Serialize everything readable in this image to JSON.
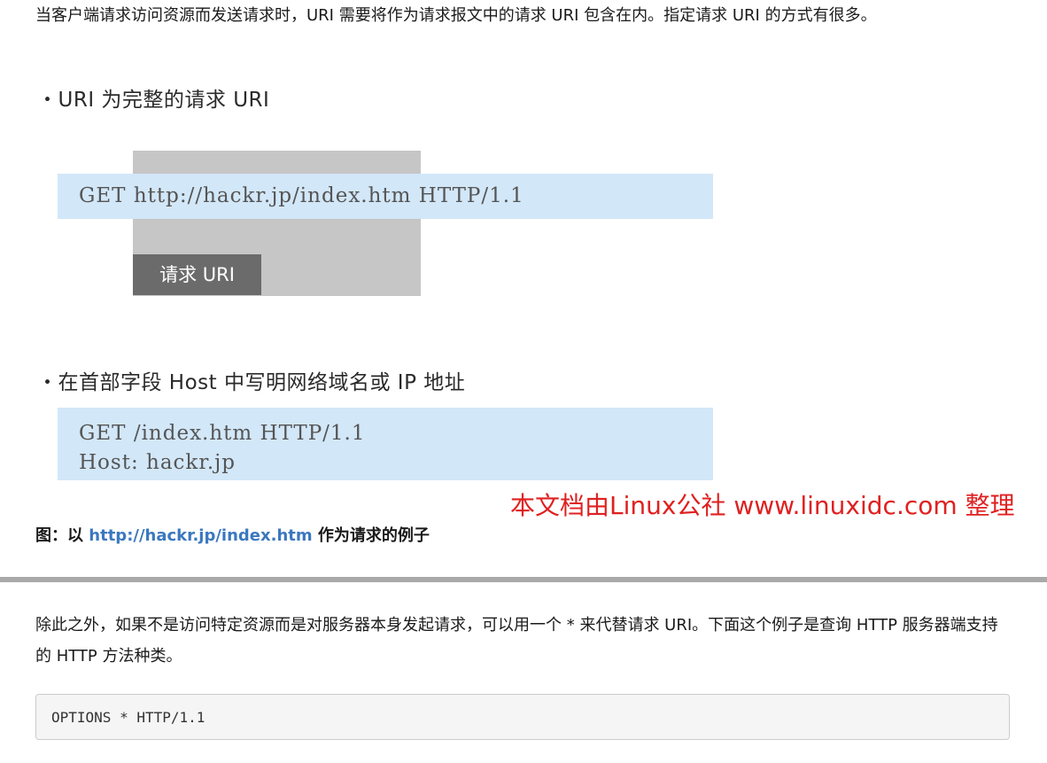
{
  "intro_paragraph": "当客户端请求访问资源而发送请求时，URI 需要将作为请求报文中的请求 URI 包含在内。指定请求 URI 的方式有很多。",
  "diagram1": {
    "bullet": "・URI 为完整的请求 URI",
    "request_line": "GET http://hackr.jp/index.htm HTTP/1.1",
    "tag_label": "请求 URI"
  },
  "diagram2": {
    "bullet": "・在首部字段 Host 中写明网络域名或 IP 地址",
    "request_line": "GET /index.htm HTTP/1.1",
    "host_line": "Host: hackr.jp"
  },
  "watermark": "本文档由Linux公社 www.linuxidc.com 整理",
  "caption": {
    "prefix": "图：以 ",
    "link": "http://hackr.jp/index.htm",
    "suffix": " 作为请求的例子"
  },
  "second_paragraph": "除此之外，如果不是访问特定资源而是对服务器本身发起请求，可以用一个 * 来代替请求 URI。下面这个例子是查询 HTTP 服务器端支持 的 HTTP 方法种类。",
  "code_block": "OPTIONS * HTTP/1.1"
}
